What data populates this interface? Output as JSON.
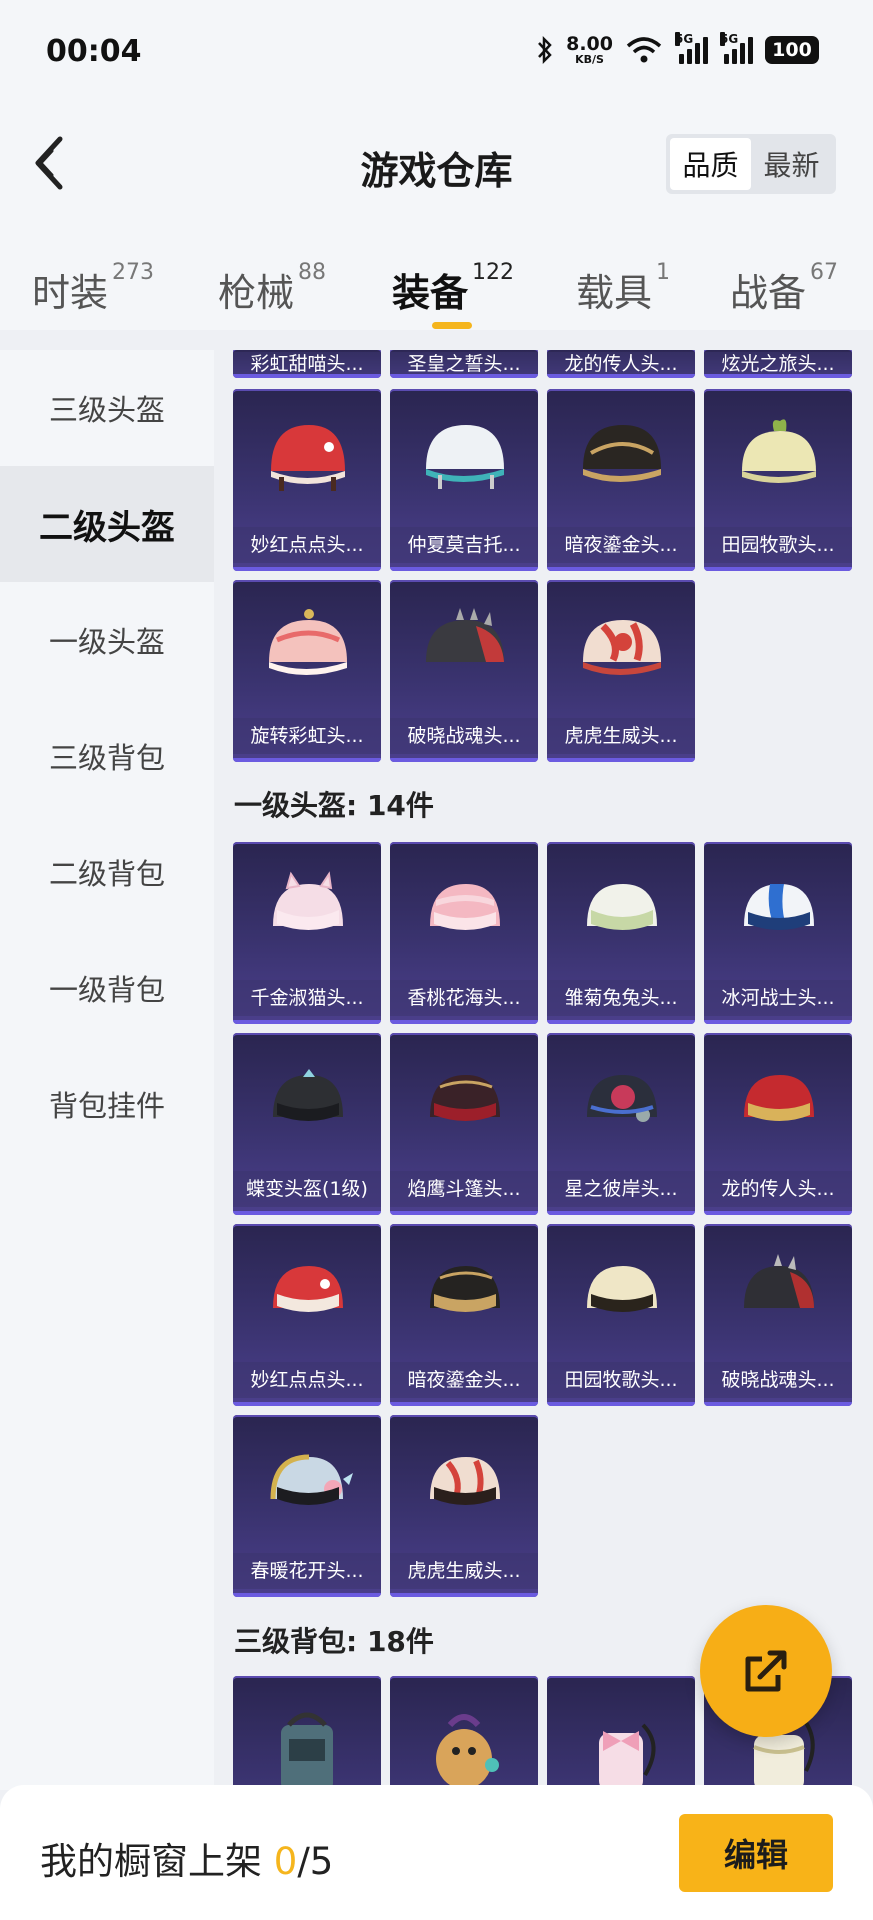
{
  "status_bar": {
    "time": "00:04",
    "speed_value": "8.00",
    "speed_unit": "KB/S",
    "network_1": "5G",
    "network_2": "5G",
    "battery": "100"
  },
  "header": {
    "title": "游戏仓库",
    "sort_options": [
      "品质",
      "最新"
    ],
    "sort_active": "品质"
  },
  "tabs": [
    {
      "label": "时装",
      "count": "273"
    },
    {
      "label": "枪械",
      "count": "88"
    },
    {
      "label": "装备",
      "count": "122",
      "active": true
    },
    {
      "label": "载具",
      "count": "1"
    },
    {
      "label": "战备",
      "count": "67"
    }
  ],
  "sidebar": {
    "items": [
      "三级头盔",
      "二级头盔",
      "一级头盔",
      "三级背包",
      "二级背包",
      "一级背包",
      "背包挂件"
    ],
    "active": "二级头盔"
  },
  "content": {
    "partial_row": [
      "彩虹甜喵头...",
      "圣皇之誓头...",
      "龙的传人头...",
      "炫光之旅头..."
    ],
    "level2_helmets": [
      {
        "name": "妙红点点头...",
        "icon": "red-helmet-icon"
      },
      {
        "name": "仲夏莫吉托...",
        "icon": "white-teal-helmet-icon"
      },
      {
        "name": "暗夜鎏金头...",
        "icon": "black-gold-helmet-icon"
      },
      {
        "name": "田园牧歌头...",
        "icon": "cream-leaf-helmet-icon"
      },
      {
        "name": "旋转彩虹头...",
        "icon": "pink-carousel-helmet-icon"
      },
      {
        "name": "破晓战魂头...",
        "icon": "spiked-dark-helmet-icon"
      },
      {
        "name": "虎虎生威头...",
        "icon": "tiger-pattern-helmet-icon"
      }
    ],
    "level1_header": "一级头盔: 14件",
    "level1_helmets": [
      {
        "name": "千金淑猫头...",
        "icon": "pink-cat-helmet-icon"
      },
      {
        "name": "香桃花海头...",
        "icon": "peach-helmet-icon"
      },
      {
        "name": "雏菊兔兔头...",
        "icon": "daisy-helmet-icon"
      },
      {
        "name": "冰河战士头...",
        "icon": "blue-stripe-helmet-icon"
      },
      {
        "name": "蝶变头盔(1级)",
        "icon": "black-butterfly-helmet-icon"
      },
      {
        "name": "焰鹰斗篷头...",
        "icon": "dark-red-helmet-icon"
      },
      {
        "name": "星之彼岸头...",
        "icon": "tech-helmet-icon"
      },
      {
        "name": "龙的传人头...",
        "icon": "red-gold-helmet-icon"
      },
      {
        "name": "妙红点点头...",
        "icon": "red-helmet-icon"
      },
      {
        "name": "暗夜鎏金头...",
        "icon": "black-gold-helmet-icon"
      },
      {
        "name": "田园牧歌头...",
        "icon": "cream-helmet-icon"
      },
      {
        "name": "破晓战魂头...",
        "icon": "spiked-dark-helmet-icon"
      },
      {
        "name": "春暖花开头...",
        "icon": "flower-helmet-icon"
      },
      {
        "name": "虎虎生威头...",
        "icon": "tiger-pattern-helmet-icon"
      }
    ],
    "level3_backpack_header": "三级背包: 18件",
    "level3_backpacks": [
      {
        "icon": "tactical-backpack-icon"
      },
      {
        "icon": "plush-backpack-icon"
      },
      {
        "icon": "bow-backpack-icon"
      },
      {
        "icon": "lace-backpack-icon"
      }
    ]
  },
  "bottom_bar": {
    "label": "我的橱窗上架 ",
    "count": "0",
    "total": "/5",
    "edit": "编辑"
  },
  "colors": {
    "accent": "#f5b51d",
    "card_bg": "#3a336f",
    "card_border": "#6b5be0"
  }
}
